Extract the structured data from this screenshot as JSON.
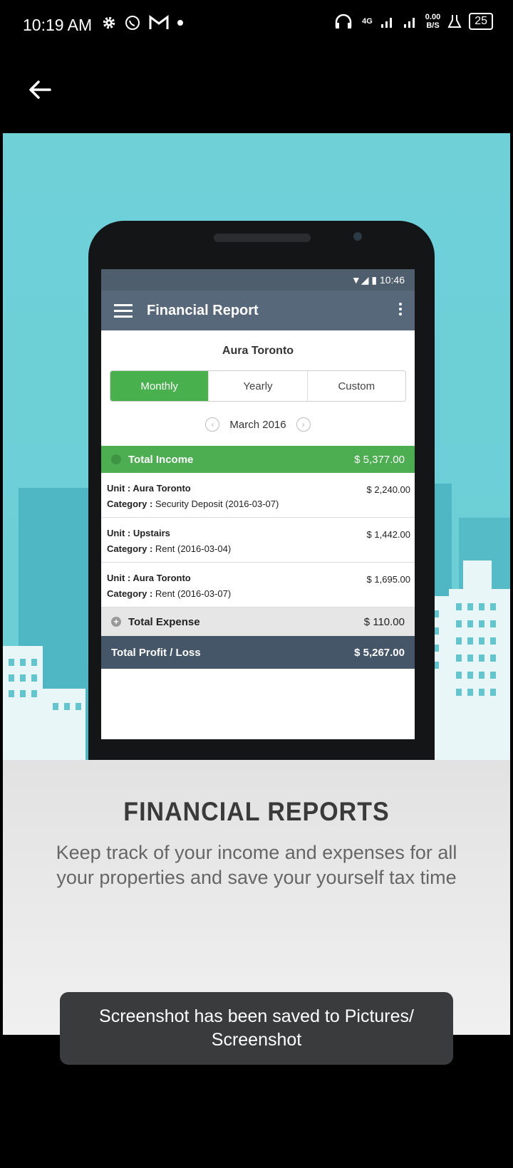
{
  "status_bar": {
    "time": "10:19 AM",
    "network": "4G",
    "speed_value": "0.00",
    "speed_unit": "B/S",
    "battery": "25"
  },
  "app_bar": {
    "back_icon": "arrow-left-icon"
  },
  "promo": {
    "phone": {
      "status_time": "10:46",
      "toolbar_title": "Financial Report",
      "property_name": "Aura Toronto",
      "tabs": [
        {
          "label": "Monthly",
          "active": true
        },
        {
          "label": "Yearly",
          "active": false
        },
        {
          "label": "Custom",
          "active": false
        }
      ],
      "period": "March 2016",
      "total_income": {
        "label": "Total Income",
        "amount": "$ 5,377.00"
      },
      "items": [
        {
          "unit_label": "Unit :",
          "unit": "Aura Toronto",
          "category_label": "Category :",
          "category": "Security Deposit (2016-03-07)",
          "amount": "$ 2,240.00"
        },
        {
          "unit_label": "Unit :",
          "unit": "Upstairs",
          "category_label": "Category :",
          "category": "Rent (2016-03-04)",
          "amount": "$ 1,442.00"
        },
        {
          "unit_label": "Unit :",
          "unit": "Aura Toronto",
          "category_label": "Category :",
          "category": "Rent (2016-03-07)",
          "amount": "$ 1,695.00"
        }
      ],
      "total_expense": {
        "label": "Total Expense",
        "amount": "$ 110.00"
      },
      "total_profit": {
        "label": "Total Profit / Loss",
        "amount": "$ 5,267.00"
      }
    },
    "title": "FINANCIAL REPORTS",
    "description": "Keep track of your income and expenses for all your properties and save your yourself tax time"
  },
  "toast": {
    "message": "Screenshot has been saved to  Pictures/ Screenshot"
  },
  "colors": {
    "background": "#000000",
    "sky": "#6fd0d8",
    "green": "#48b04d",
    "toolbar": "#56687a",
    "profit": "#455668"
  }
}
